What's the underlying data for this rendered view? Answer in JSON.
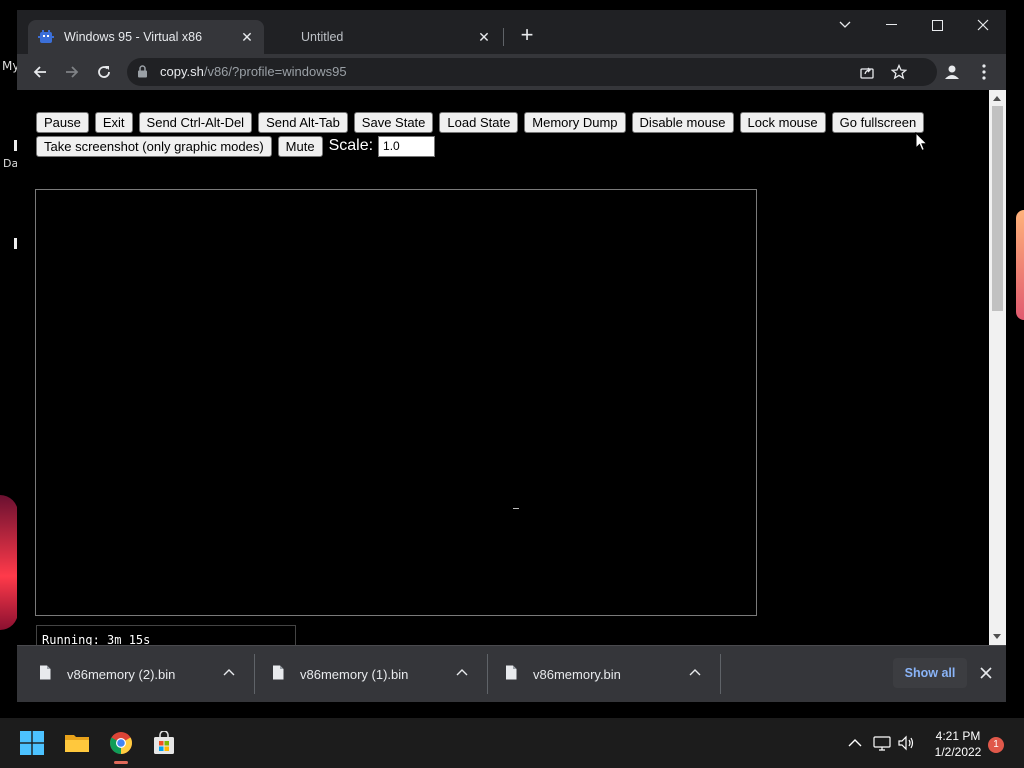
{
  "desktop": {
    "labels": [
      "My",
      "Da"
    ]
  },
  "browser": {
    "tabs": [
      {
        "title": "Windows 95 - Virtual x86",
        "active": true
      },
      {
        "title": "Untitled",
        "active": false
      }
    ],
    "address": {
      "host": "copy.sh",
      "path": "/v86/?profile=windows95"
    }
  },
  "emulator": {
    "buttons": [
      "Pause",
      "Exit",
      "Send Ctrl-Alt-Del",
      "Send Alt-Tab",
      "Save State",
      "Load State",
      "Memory Dump",
      "Disable mouse",
      "Lock mouse",
      "Go fullscreen"
    ],
    "buttons_row2": [
      "Take screenshot (only graphic modes)",
      "Mute"
    ],
    "scale_label": "Scale:",
    "scale_value": "1.0",
    "status": "Running: 3m 15s"
  },
  "downloads": {
    "items": [
      "v86memory (2).bin",
      "v86memory (1).bin",
      "v86memory.bin"
    ],
    "show_all": "Show all"
  },
  "taskbar": {
    "apps": [
      "start-icon",
      "file-explorer-icon",
      "chrome-icon",
      "store-icon"
    ],
    "time": "4:21 PM",
    "date": "1/2/2022",
    "notification_count": "1"
  },
  "colors": {
    "browser_frame": "#202124",
    "toolbar": "#35363a",
    "link_blue": "#8ab4f8",
    "badge_red": "#e0584a"
  }
}
